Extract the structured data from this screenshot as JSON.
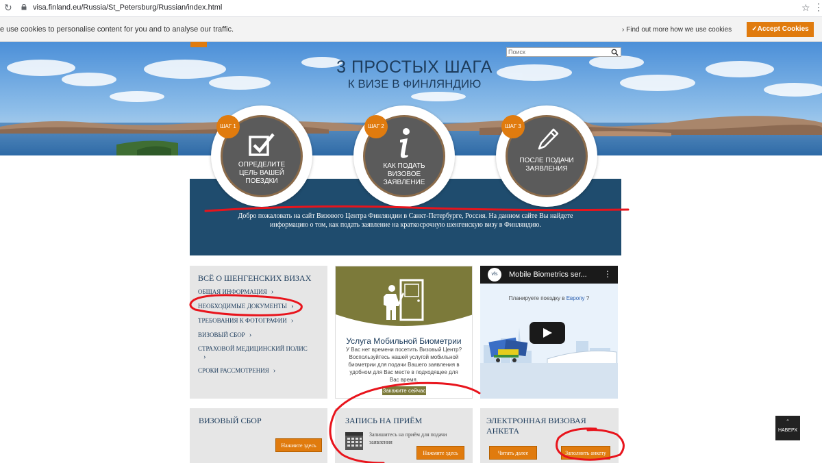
{
  "browser": {
    "url": "visa.finland.eu/Russia/St_Petersburg/Russian/index.html"
  },
  "cookie_bar": {
    "text": "e use cookies to personalise content for you and to analyse our traffic.",
    "link_label": "Find out more how we use cookies",
    "accept_label": "Accept Cookies"
  },
  "search": {
    "placeholder": "Поиск"
  },
  "hero": {
    "title": "3 ПРОСТЫХ ШАГА",
    "subtitle": "К ВИЗЕ В ФИНЛЯНДИЮ"
  },
  "steps": [
    {
      "badge": "ШАГ 1",
      "label": "ОПРЕДЕЛИТЕ ЦЕЛЬ ВАШЕЙ ПОЕЗДКИ",
      "icon": "checkbox-icon"
    },
    {
      "badge": "ШАГ 2",
      "label": "КАК ПОДАТЬ ВИЗОВОЕ ЗАЯВЛЕНИЕ",
      "icon": "info-icon"
    },
    {
      "badge": "ШАГ 3",
      "label": "ПОСЛЕ ПОДАЧИ ЗАЯВЛЕНИЯ",
      "icon": "pencil-icon"
    }
  ],
  "welcome": {
    "line1": "Добро пожаловать на сайт Визового Центра Финляндии в Санкт-Петербурге, Россия. На данном сайте Вы найдете",
    "line2": "информацию о том, как подать заявление на краткосрочную шенгенскую визу в Финляндию."
  },
  "schengen": {
    "title": "ВСЁ О ШЕНГЕНСКИХ ВИЗАХ",
    "links": [
      {
        "label": "ОБЩАЯ ИНФОРМАЦИЯ"
      },
      {
        "label": "НЕОБХОДИМЫЕ ДОКУМЕНТЫ"
      },
      {
        "label": "ТРЕБОВАНИЯ К ФОТОГРАФИИ"
      },
      {
        "label": "ВИЗОВЫЙ СБОР"
      },
      {
        "label": "СТРАХОВОЙ МЕДИЦИНСКИЙ ПОЛИС"
      },
      {
        "label": "СРОКИ РАССМОТРЕНИЯ"
      }
    ]
  },
  "biometrics": {
    "title": "Услуга Мобильной Биометрии",
    "description": "У Вас нет времени посетить Визовый Центр? Воспользуйтесь нашей услугой мобильной биометрии для подачи Вашего заявления в удобном для Вас месте в подходящее для Вас время.",
    "button": "Закажите сейчас"
  },
  "video": {
    "logo": "vfs",
    "title": "Mobile Biometrics ser...",
    "caption_prefix": "Планируете поездку в ",
    "caption_highlight": "Европу",
    "caption_suffix": " ?"
  },
  "bottom": {
    "visa_fee": {
      "title": "ВИЗОВЫЙ СБОР",
      "button": "Нажмите здесь"
    },
    "appointment": {
      "title": "ЗАПИСЬ НА ПРИЁМ",
      "text": "Запишитесь на приём для подачи заявления",
      "button": "Нажмите здесь"
    },
    "eform": {
      "title": "ЭЛЕКТРОННАЯ ВИЗОВАЯ АНКЕТА",
      "read_button": "Читать далее",
      "fill_button": "Заполнить анкету"
    }
  },
  "back_to_top": "НАВЕРХ",
  "colors": {
    "accent_orange": "#e07b0e",
    "navy": "#1f4c6e",
    "olive": "#7c7a3a",
    "annotation_red": "#e8141c"
  }
}
